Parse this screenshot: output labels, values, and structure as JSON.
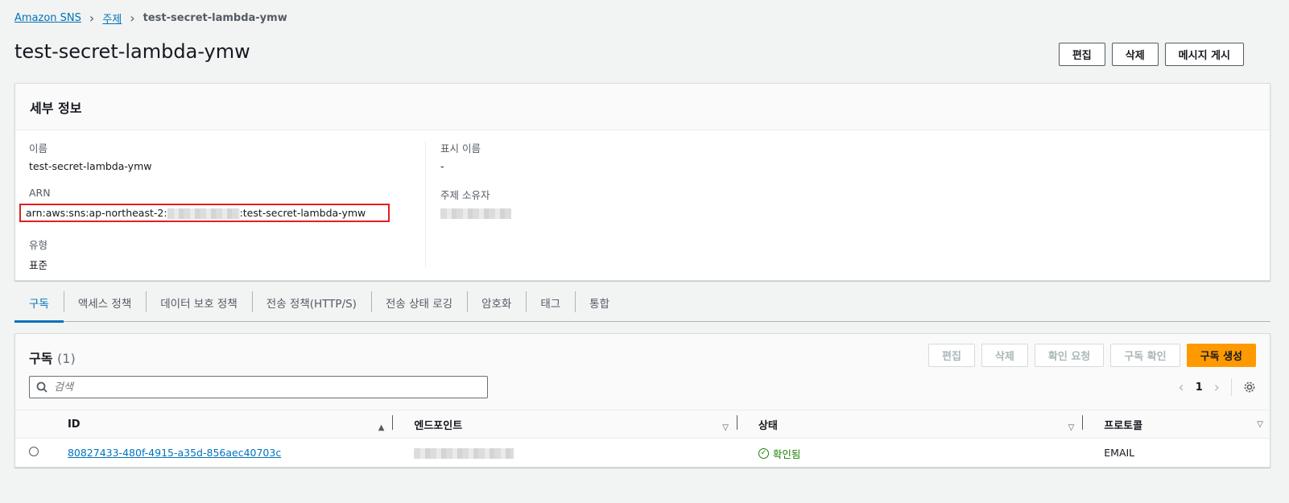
{
  "breadcrumb": {
    "items": [
      "Amazon SNS",
      "주제"
    ],
    "current": "test-secret-lambda-ymw"
  },
  "page": {
    "title": "test-secret-lambda-ymw",
    "actions": [
      "편집",
      "삭제",
      "메시지 게시"
    ]
  },
  "details": {
    "heading": "세부 정보",
    "name_label": "이름",
    "name_value": "test-secret-lambda-ymw",
    "arn_label": "ARN",
    "arn_prefix": "arn:aws:sns:ap-northeast-2:",
    "arn_suffix": ":test-secret-lambda-ymw",
    "type_label": "유형",
    "type_value": "표준",
    "display_name_label": "표시 이름",
    "display_name_value": "-",
    "owner_label": "주제 소유자"
  },
  "tabs": [
    "구독",
    "액세스 정책",
    "데이터 보호 정책",
    "전송 정책(HTTP/S)",
    "전송 상태 로깅",
    "암호화",
    "태그",
    "통합"
  ],
  "subscriptions": {
    "title": "구독",
    "count": "(1)",
    "actions": [
      "편집",
      "삭제",
      "확인 요청",
      "구독 확인"
    ],
    "create_label": "구독 생성",
    "search_placeholder": "검색",
    "page": "1",
    "columns": [
      "ID",
      "엔드포인트",
      "상태",
      "프로토콜"
    ],
    "rows": [
      {
        "id": "80827433-480f-4915-a35d-856aec40703c",
        "status": "확인됨",
        "protocol": "EMAIL"
      }
    ]
  },
  "colors": {
    "link": "#0073bb",
    "primary": "#ff9900",
    "success": "#1d8102",
    "highlight": "#e02020"
  }
}
